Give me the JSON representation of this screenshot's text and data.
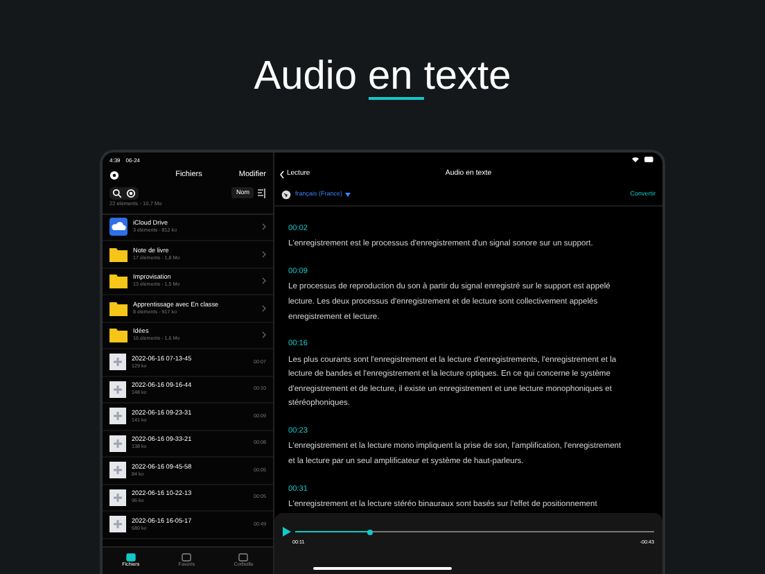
{
  "headline": "Audio en texte",
  "status_bar": {
    "time": "4:39",
    "date": "06-24"
  },
  "files": {
    "title": "Fichiers",
    "edit": "Modifier",
    "sort": "Nom",
    "summary": "22 éléments - 10,7 Mo",
    "items": [
      {
        "kind": "cloud",
        "name": "iCloud Drive",
        "info": "3 éléments - 812 ko"
      },
      {
        "kind": "folder",
        "name": "Note de livre",
        "info": "17 éléments - 1,8 Mo"
      },
      {
        "kind": "folder",
        "name": "Improvisation",
        "info": "13 éléments - 1,5 Mo"
      },
      {
        "kind": "folder",
        "name": "Apprentissage avec En classe",
        "info": "8 éléments - 917 ko"
      },
      {
        "kind": "folder",
        "name": "Idées",
        "info": "16 éléments - 1,6 Mo"
      },
      {
        "kind": "audio",
        "name": "2022-06-16 07-13-45",
        "info": "129 ko",
        "duration": "00:07"
      },
      {
        "kind": "audio",
        "name": "2022-06-16 09-16-44",
        "info": "148 ko",
        "duration": "00:10"
      },
      {
        "kind": "audio",
        "name": "2022-06-16 09-23-31",
        "info": "141 ko",
        "duration": "00:09"
      },
      {
        "kind": "audio",
        "name": "2022-06-16 09-33-21",
        "info": "138 ko",
        "duration": "00:08"
      },
      {
        "kind": "audio",
        "name": "2022-06-16 09-45-58",
        "info": "84 ko",
        "duration": "00:05"
      },
      {
        "kind": "audio",
        "name": "2022-06-16 10-22-13",
        "info": "96 ko",
        "duration": "00:05"
      },
      {
        "kind": "audio",
        "name": "2022-06-16 16-05-17",
        "info": "680 ko",
        "duration": "00:49"
      }
    ],
    "tabs": [
      {
        "label": "Fichiers",
        "selected": true
      },
      {
        "label": "Favoris",
        "selected": false
      },
      {
        "label": "Corbeille",
        "selected": false
      }
    ]
  },
  "detail": {
    "back": "Lecture",
    "title": "Audio en texte",
    "language": "français (France)",
    "convert": "Convertir",
    "segments": [
      {
        "time": "00:02",
        "text": "L'enregistrement est le processus d'enregistrement d'un signal sonore sur un support."
      },
      {
        "time": "00:09",
        "text": "Le processus de reproduction du son à partir du signal enregistré sur le support est appelé lecture. Les deux processus d'enregistrement et de lecture sont collectivement appelés enregistrement et lecture."
      },
      {
        "time": "00:16",
        "text": "Les plus courants sont l'enregistrement et la lecture d'enregistrements, l'enregistrement et la lecture de bandes et l'enregistrement et la lecture optiques. En ce qui concerne le système d'enregistrement et de lecture, il existe un enregistrement et une lecture monophoniques et stéréophoniques."
      },
      {
        "time": "00:23",
        "text": "L'enregistrement et la lecture mono impliquent la prise de son, l'amplification, l'enregistrement et la lecture par un seul amplificateur et système de haut-parleurs."
      },
      {
        "time": "00:31",
        "text": "L'enregistrement et la lecture stéréo binauraux sont basés sur l'effet de positionnement"
      }
    ],
    "player": {
      "level": 0.21,
      "elapsed": "00:11",
      "remaining": "-00:43"
    }
  }
}
